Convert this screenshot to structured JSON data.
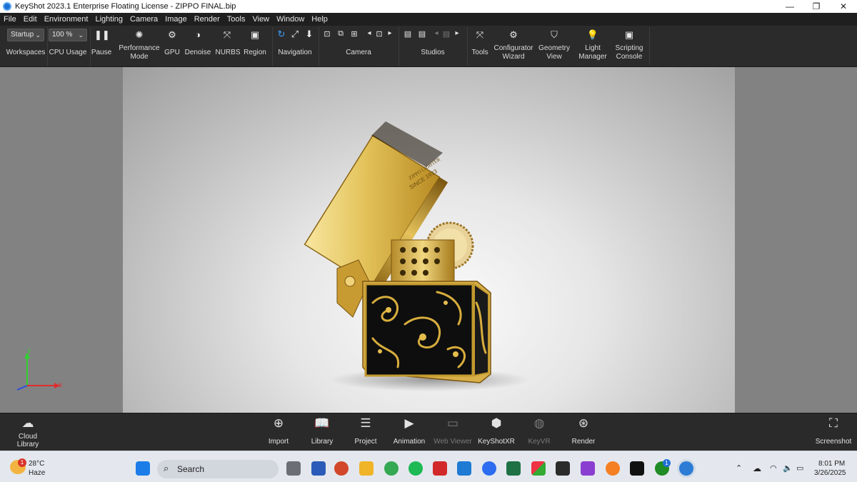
{
  "window": {
    "title": "KeyShot 2023.1 Enterprise Floating License  - ZIPPO FINAL.bip"
  },
  "menu": [
    "File",
    "Edit",
    "Environment",
    "Lighting",
    "Camera",
    "Image",
    "Render",
    "Tools",
    "View",
    "Window",
    "Help"
  ],
  "ribbon": {
    "workspace_value": "Startup",
    "cpu_value": "100 %",
    "workspaces_label": "Workspaces",
    "cpu_label": "CPU Usage",
    "pause_label": "Pause",
    "performance_label_1": "Performance",
    "performance_label_2": "Mode",
    "gpu_label": "GPU",
    "denoise_label": "Denoise",
    "nurbs_label": "NURBS",
    "region_label": "Region",
    "navigation_label": "Navigation",
    "camera_label": "Camera",
    "studios_label": "Studios",
    "tools_label": "Tools",
    "configurator_label_1": "Configurator",
    "configurator_label_2": "Wizard",
    "geometry_label_1": "Geometry",
    "geometry_label_2": "View",
    "light_label_1": "Light",
    "light_label_2": "Manager",
    "scripting_label_1": "Scripting",
    "scripting_label_2": "Console"
  },
  "viewport": {
    "engraving_1": "ZIPPO LIGHTER",
    "engraving_2": "SINCE 1933",
    "axis_y": "y",
    "axis_x": "x"
  },
  "dock": {
    "cloud_library_1": "Cloud",
    "cloud_library_2": "Library",
    "import": "Import",
    "library": "Library",
    "project": "Project",
    "animation": "Animation",
    "web_viewer": "Web Viewer",
    "keyshotxr": "KeyShotXR",
    "keyvr": "KeyVR",
    "render": "Render",
    "screenshot": "Screenshot"
  },
  "taskbar": {
    "weather_temp": "28°C",
    "weather_desc": "Haze",
    "weather_badge": "1",
    "search_label": "Search",
    "time": "8:01 PM",
    "date": "3/26/2025",
    "xbox_badge": "1"
  },
  "colors": {
    "accent": "#3da0ff",
    "gold": "#c9a030",
    "viewport": "#e6e6e6"
  }
}
